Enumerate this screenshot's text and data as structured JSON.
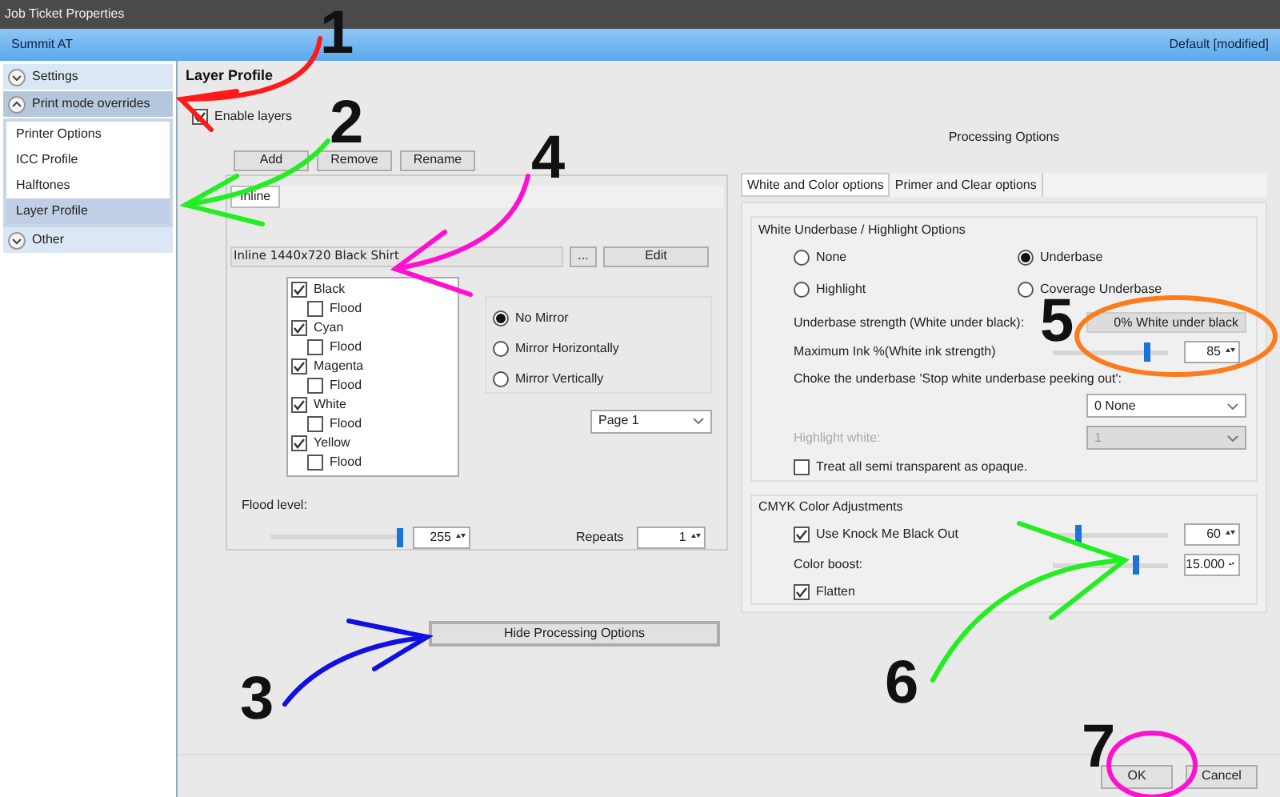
{
  "window": {
    "title": "Job Ticket Properties"
  },
  "header": {
    "printer": "Summit AT",
    "preset": "Default [modified]"
  },
  "sidebar": {
    "sections": [
      {
        "label": "Settings",
        "expanded": false
      },
      {
        "label": "Print mode overrides",
        "expanded": true,
        "items": [
          {
            "label": "Printer Options",
            "selected": false
          },
          {
            "label": "ICC Profile",
            "selected": false
          },
          {
            "label": "Halftones",
            "selected": false
          },
          {
            "label": "Layer Profile",
            "selected": true
          }
        ]
      },
      {
        "label": "Other",
        "expanded": false
      }
    ]
  },
  "layer_profile": {
    "title": "Layer Profile",
    "enable_layers": {
      "label": "Enable layers",
      "checked": true
    },
    "buttons": [
      "Add",
      "Remove",
      "Rename"
    ],
    "tabs": [
      {
        "label": "Inline",
        "selected": true
      }
    ],
    "profile_field": {
      "value": "Inline 1440x720 Black Shirt"
    },
    "browse_button": "...",
    "edit_button": "Edit",
    "channels": [
      {
        "label": "Black",
        "checked": true,
        "flood": {
          "label": "Flood",
          "checked": false
        }
      },
      {
        "label": "Cyan",
        "checked": true,
        "flood": {
          "label": "Flood",
          "checked": false
        }
      },
      {
        "label": "Magenta",
        "checked": true,
        "flood": {
          "label": "Flood",
          "checked": false
        }
      },
      {
        "label": "White",
        "checked": true,
        "flood": {
          "label": "Flood",
          "checked": false
        }
      },
      {
        "label": "Yellow",
        "checked": true,
        "flood": {
          "label": "Flood",
          "checked": false
        }
      }
    ],
    "mirror": [
      {
        "label": "No Mirror",
        "selected": true
      },
      {
        "label": "Mirror Horizontally",
        "selected": false
      },
      {
        "label": "Mirror Vertically",
        "selected": false
      }
    ],
    "page": "Page 1",
    "flood_level": {
      "label": "Flood level:",
      "level": 1.0,
      "value": "255"
    },
    "repeats": {
      "label": "Repeats",
      "value": "1"
    },
    "hide_button": "Hide Processing Options"
  },
  "processing": {
    "title": "Processing Options",
    "tabs": [
      {
        "label": "White and Color options",
        "selected": true
      },
      {
        "label": "Primer and Clear options",
        "selected": false
      }
    ],
    "white_group": {
      "title": "White Underbase / Highlight Options",
      "options": [
        {
          "label": "None",
          "selected": false
        },
        {
          "label": "Underbase",
          "selected": true
        },
        {
          "label": "Highlight",
          "selected": false
        },
        {
          "label": "Coverage Underbase",
          "selected": false
        }
      ],
      "underbase_strength": {
        "label": "Underbase strength (White under black):",
        "value": "0% White under black"
      },
      "max_ink": {
        "label": "Maximum Ink %(White ink strength)",
        "level": 0.85,
        "value": "85"
      },
      "choke": {
        "label": "Choke the underbase 'Stop white underbase peeking out':",
        "value": "0 None"
      },
      "highlight_white": {
        "label": "Highlight white:",
        "value": "1",
        "disabled": true
      },
      "treat_opaque": {
        "label": "Treat all semi transparent as opaque.",
        "checked": false
      }
    },
    "cmyk_group": {
      "title": "CMYK Color Adjustments",
      "knockout": {
        "label": "Use Knock Me Black Out",
        "checked": true,
        "level": 0.25,
        "value": "60"
      },
      "color_boost": {
        "label": "Color boost:",
        "level": 0.75,
        "value": "15.000"
      },
      "flatten": {
        "label": "Flatten",
        "checked": true
      }
    }
  },
  "footer": {
    "buttons": [
      "OK",
      "Cancel"
    ]
  },
  "annotations": [
    {
      "label": "1",
      "color": "#ff1a1a"
    },
    {
      "label": "2",
      "color": "#22ee22"
    },
    {
      "label": "3",
      "color": "#1010e0"
    },
    {
      "label": "4",
      "color": "#ff10d0"
    },
    {
      "label": "5",
      "color": "#ff7a1a"
    },
    {
      "label": "6",
      "color": "#22ee22"
    },
    {
      "label": "7",
      "color": "#ff10d0"
    }
  ]
}
